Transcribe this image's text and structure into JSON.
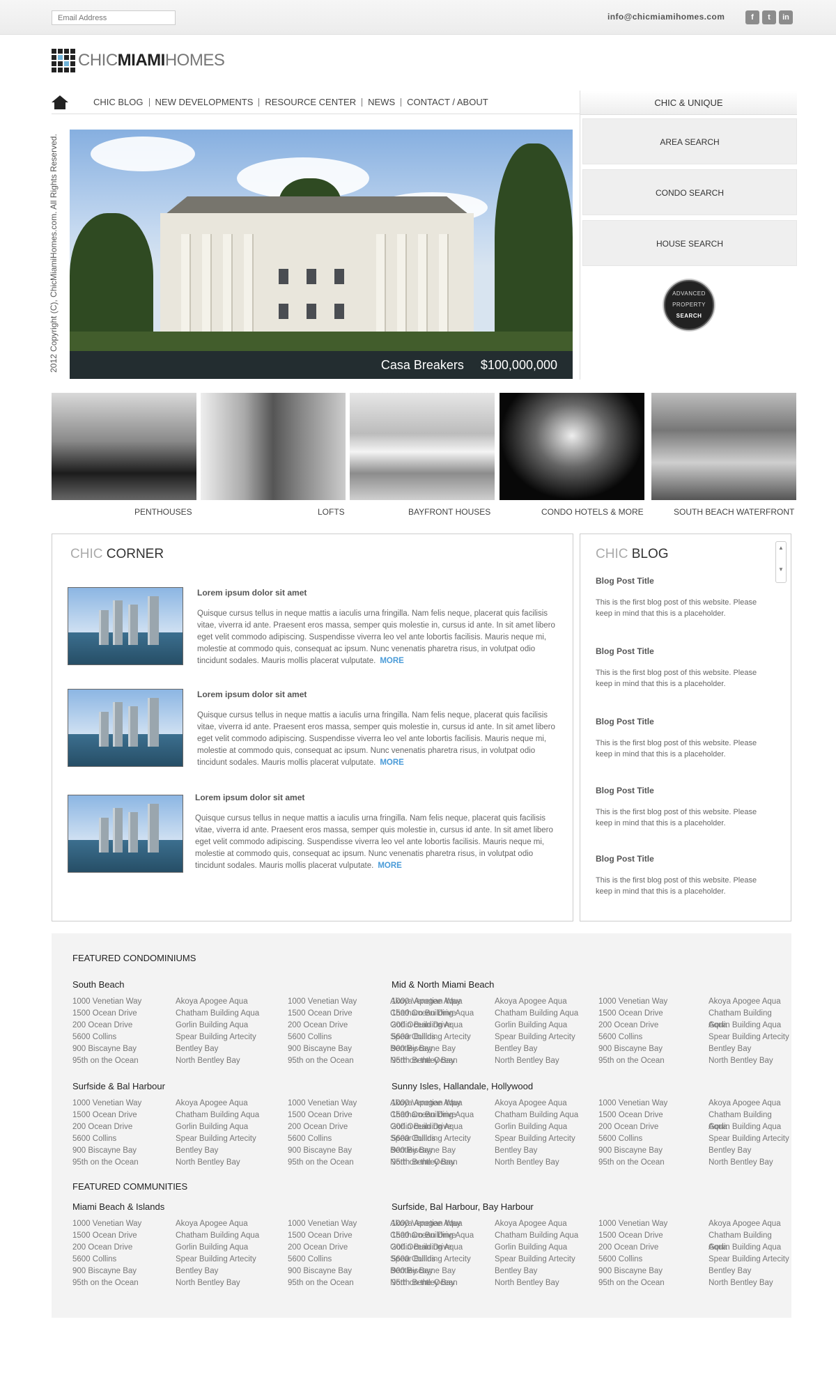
{
  "header": {
    "email_placeholder": "Email Address",
    "contact_email": "info@chicmiamihomes.com",
    "social": [
      "f",
      "t",
      "in"
    ]
  },
  "logo": {
    "part1": "CHIC",
    "part2": "MIAMI",
    "part3": "HOMES"
  },
  "nav": {
    "items": [
      "CHIC BLOG",
      "NEW DEVELOPMENTS",
      "RESOURCE CENTER",
      "NEWS",
      "CONTACT / ABOUT"
    ]
  },
  "side": {
    "title": "CHIC & UNIQUE",
    "buttons": [
      "AREA SEARCH",
      "CONDO SEARCH",
      "HOUSE SEARCH"
    ],
    "adv_line1": "ADVANCED",
    "adv_line2": "PROPERTY",
    "adv_line3": "SEARCH"
  },
  "copyright": "2012 Copyright (C), ChicMiamiHomes.com. All Rights Reserved.",
  "hero": {
    "name": "Casa Breakers",
    "price": "$100,000,000"
  },
  "categories": [
    "PENTHOUSES",
    "LOFTS",
    "BAYFRONT HOUSES",
    "CONDO HOTELS & MORE",
    "SOUTH BEACH WATERFRONT"
  ],
  "corner": {
    "title_light": "CHIC",
    "title_dark": "CORNER",
    "posts": [
      {
        "title": "Lorem ipsum dolor sit amet",
        "body": "Quisque cursus tellus in neque mattis a iaculis urna fringilla. Nam felis neque, placerat quis facilisis vitae, viverra id ante. Praesent eros massa, semper quis molestie in, cursus id ante. In sit amet libero eget velit commodo adipiscing. Suspendisse viverra leo vel ante lobortis facilisis. Mauris neque mi, molestie at commodo quis, consequat ac ipsum. Nunc venenatis pharetra risus, in volutpat odio tincidunt sodales. Mauris mollis placerat vulputate.",
        "more": "MORE"
      },
      {
        "title": "Lorem ipsum dolor sit amet",
        "body": "Quisque cursus tellus in neque mattis a iaculis urna fringilla. Nam felis neque, placerat quis facilisis vitae, viverra id ante. Praesent eros massa, semper quis molestie in, cursus id ante. In sit amet libero eget velit commodo adipiscing. Suspendisse viverra leo vel ante lobortis facilisis. Mauris neque mi, molestie at commodo quis, consequat ac ipsum. Nunc venenatis pharetra risus, in volutpat odio tincidunt sodales. Mauris mollis placerat vulputate.",
        "more": "MORE"
      },
      {
        "title": "Lorem ipsum dolor sit amet",
        "body": "Quisque cursus tellus in neque mattis a iaculis urna fringilla. Nam felis neque, placerat quis facilisis vitae, viverra id ante. Praesent eros massa, semper quis molestie in, cursus id ante. In sit amet libero eget velit commodo adipiscing. Suspendisse viverra leo vel ante lobortis facilisis. Mauris neque mi, molestie at commodo quis, consequat ac ipsum. Nunc venenatis pharetra risus, in volutpat odio tincidunt sodales. Mauris mollis placerat vulputate.",
        "more": "MORE"
      }
    ]
  },
  "blog": {
    "title_light": "CHIC",
    "title_dark": "BLOG",
    "posts": [
      {
        "title": "Blog Post Title",
        "body": "This is the first blog post of this  website. Please keep in mind that this is a placeholder."
      },
      {
        "title": "Blog Post Title",
        "body": "This is the first blog post of this  website. Please keep in mind that this is a placeholder."
      },
      {
        "title": "Blog Post Title",
        "body": "This is the first blog post of this  website. Please keep in mind that this is a placeholder."
      },
      {
        "title": "Blog Post Title",
        "body": "This is the first blog post of this  website. Please keep in mind that this is a placeholder."
      },
      {
        "title": "Blog Post Title",
        "body": "This is the first blog post of this  website. Please keep in mind that this is a placeholder."
      }
    ]
  },
  "featured": {
    "condos_heading": "FEATURED CONDOMINIUMS",
    "communities_heading": "FEATURED COMMUNITIES",
    "col_a": [
      "1000 Venetian Way",
      "1500 Ocean Drive",
      "200 Ocean Drive",
      "5600 Collins",
      "900 Biscayne Bay",
      "95th on the Ocean"
    ],
    "col_b": [
      "Akoya Apogee Aqua",
      "Chatham Building Aqua",
      "Gorlin Building Aqua",
      "Spear Building Artecity",
      "Bentley Bay",
      "North Bentley Bay"
    ],
    "groups": [
      "South Beach",
      "Mid & North Miami Beach",
      "Surfside & Bal Harbour",
      "Sunny Isles, Hallandale, Hollywood",
      "Miami Beach & Islands",
      "Surfside, Bal Harbour, Bay Harbour"
    ]
  }
}
